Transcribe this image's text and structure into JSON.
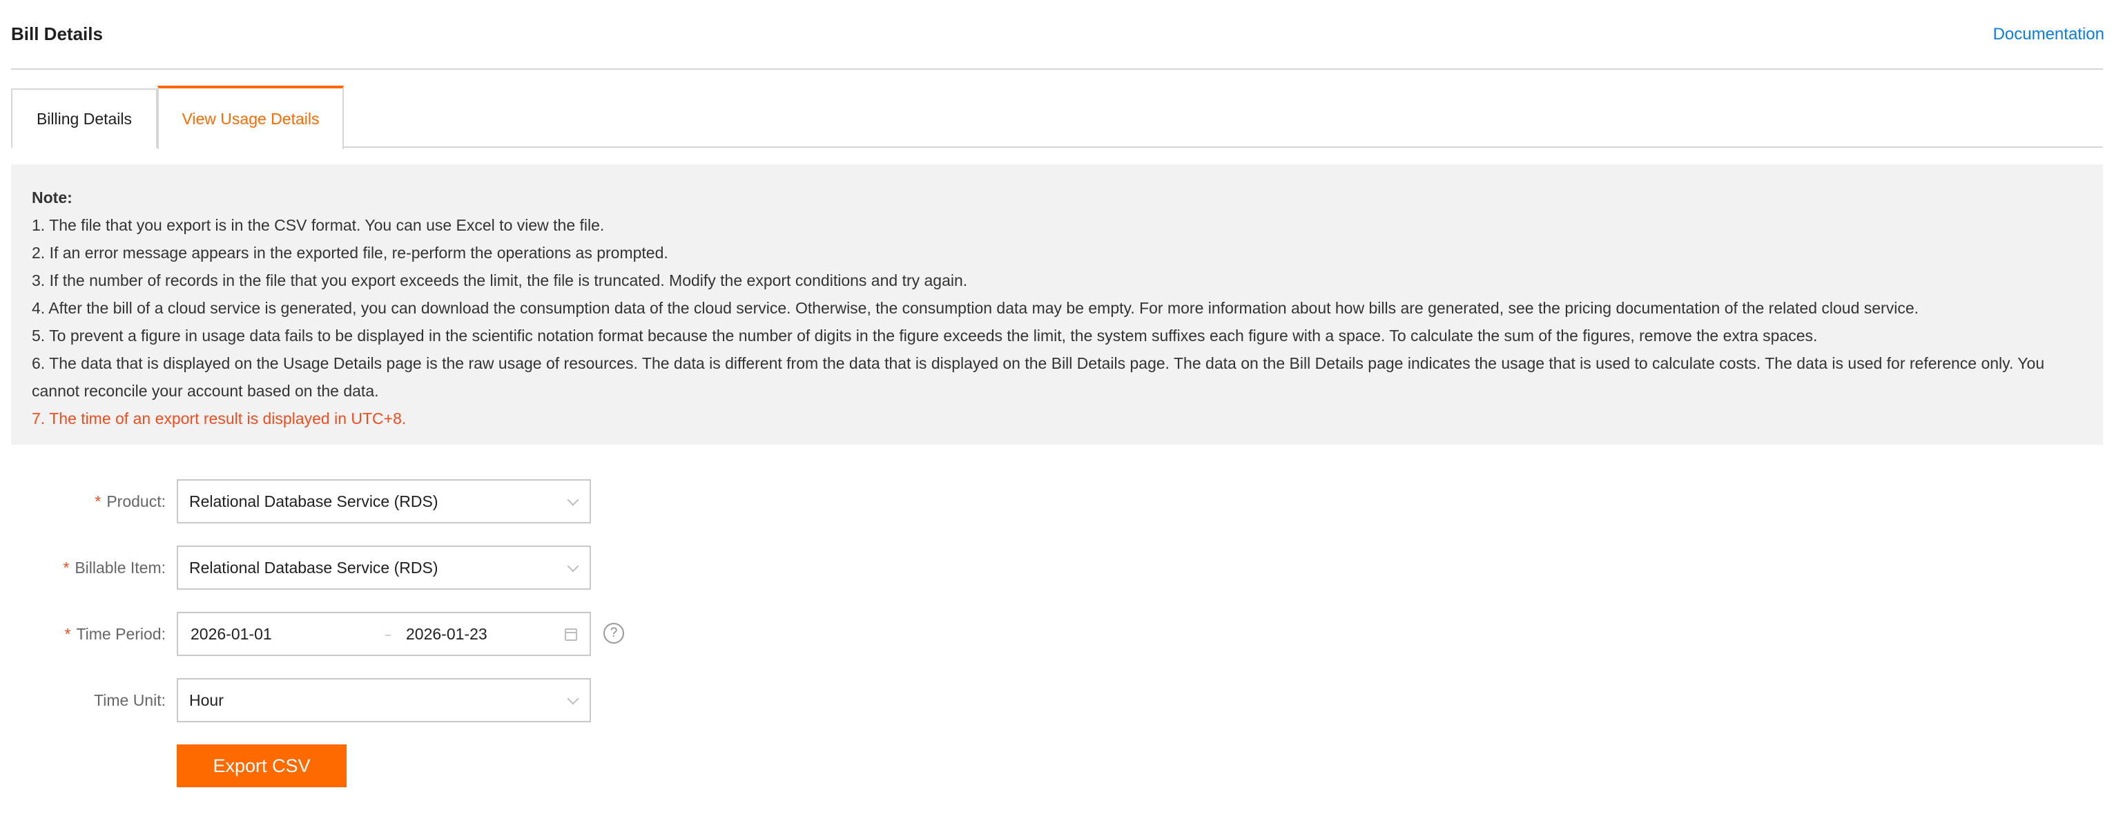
{
  "header": {
    "title": "Bill Details",
    "doc_link": "Documentation"
  },
  "tabs": [
    {
      "label": "Billing Details",
      "active": false
    },
    {
      "label": "View Usage Details",
      "active": true
    }
  ],
  "note": {
    "title": "Note:",
    "items": [
      "1. The file that you export is in the CSV format. You can use Excel to view the file.",
      "2. If an error message appears in the exported file, re-perform the operations as prompted.",
      "3. If the number of records in the file that you export exceeds the limit, the file is truncated. Modify the export conditions and try again.",
      "4. After the bill of a cloud service is generated, you can download the consumption data of the cloud service. Otherwise, the consumption data may be empty. For more information about how bills are generated, see the pricing documentation of the related cloud service.",
      "5. To prevent a figure in usage data fails to be displayed in the scientific notation format because the number of digits in the figure exceeds the limit, the system suffixes each figure with a space. To calculate the sum of the figures, remove the extra spaces.",
      "6. The data that is displayed on the Usage Details page is the raw usage of resources. The data is different from the data that is displayed on the Bill Details page. The data on the Bill Details page indicates the usage that is used to calculate costs. The data is used for reference only. You cannot reconcile your account based on the data."
    ],
    "warning": "7. The time of an export result is displayed in UTC+8."
  },
  "form": {
    "required_mark": "*",
    "product": {
      "label": "Product:",
      "value": "Relational Database Service (RDS)"
    },
    "billable_item": {
      "label": "Billable Item:",
      "value": "Relational Database Service (RDS)"
    },
    "time_period": {
      "label": "Time Period:",
      "start": "2026-01-01",
      "end": "2026-01-23",
      "help": "?"
    },
    "time_unit": {
      "label": "Time Unit:",
      "value": "Hour"
    },
    "export_button": "Export CSV"
  },
  "colors": {
    "accent": "#ff6a00",
    "link": "#0a7ee0",
    "warning": "#f04d1f"
  },
  "icons": [
    "chevron-down-icon",
    "calendar-icon",
    "help-icon"
  ]
}
